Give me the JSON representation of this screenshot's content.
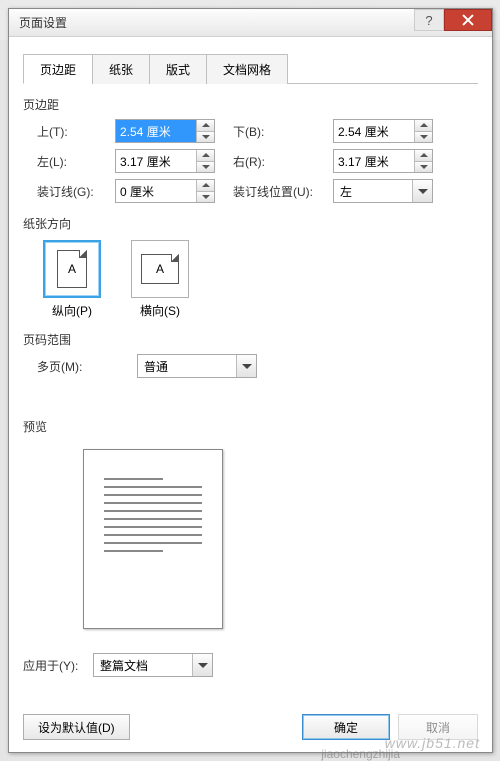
{
  "window": {
    "title": "页面设置"
  },
  "tabs": [
    {
      "label": "页边距",
      "active": true
    },
    {
      "label": "纸张",
      "active": false
    },
    {
      "label": "版式",
      "active": false
    },
    {
      "label": "文档网格",
      "active": false
    }
  ],
  "margins": {
    "group_label": "页边距",
    "top_label": "上(T):",
    "top_value": "2.54 厘米",
    "bottom_label": "下(B):",
    "bottom_value": "2.54 厘米",
    "left_label": "左(L):",
    "left_value": "3.17 厘米",
    "right_label": "右(R):",
    "right_value": "3.17 厘米",
    "gutter_label": "装订线(G):",
    "gutter_value": "0 厘米",
    "gutter_pos_label": "装订线位置(U):",
    "gutter_pos_value": "左"
  },
  "orientation": {
    "group_label": "纸张方向",
    "portrait_label": "纵向(P)",
    "landscape_label": "横向(S)",
    "glyph": "A"
  },
  "pages": {
    "group_label": "页码范围",
    "multi_label": "多页(M):",
    "multi_value": "普通"
  },
  "preview": {
    "group_label": "预览"
  },
  "apply": {
    "label": "应用于(Y):",
    "value": "整篇文档"
  },
  "buttons": {
    "default": "设为默认值(D)",
    "ok": "确定",
    "cancel": "取消"
  },
  "watermark": {
    "a": "www.jb51.net",
    "b": "jiaochengzhijia"
  }
}
